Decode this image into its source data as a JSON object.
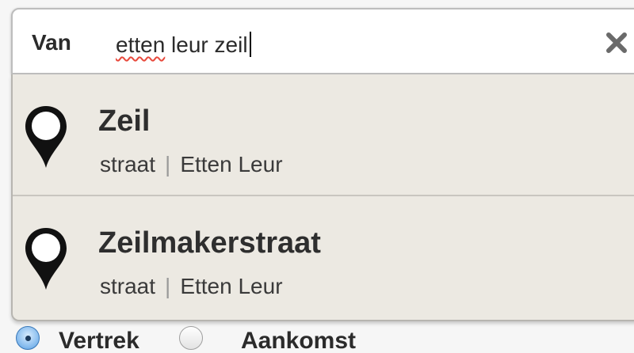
{
  "search": {
    "label": "Van",
    "value_misspelled": "etten",
    "value_rest": " leur zeil"
  },
  "suggestions": [
    {
      "title": "Zeil",
      "type": "straat",
      "separator": "|",
      "city": "Etten Leur"
    },
    {
      "title": "Zeilmakerstraat",
      "type": "straat",
      "separator": "|",
      "city": "Etten Leur"
    }
  ],
  "direction": {
    "options": [
      {
        "label": "Vertrek",
        "checked": true
      },
      {
        "label": "Aankomst",
        "checked": false
      }
    ]
  },
  "icons": {
    "clear": "close-icon",
    "suggestion": "map-pin-icon"
  },
  "colors": {
    "dropdown_bg": "#ece9e2",
    "spellcheck_underline": "#e8493c",
    "radio_selected": "#3f86cf"
  }
}
